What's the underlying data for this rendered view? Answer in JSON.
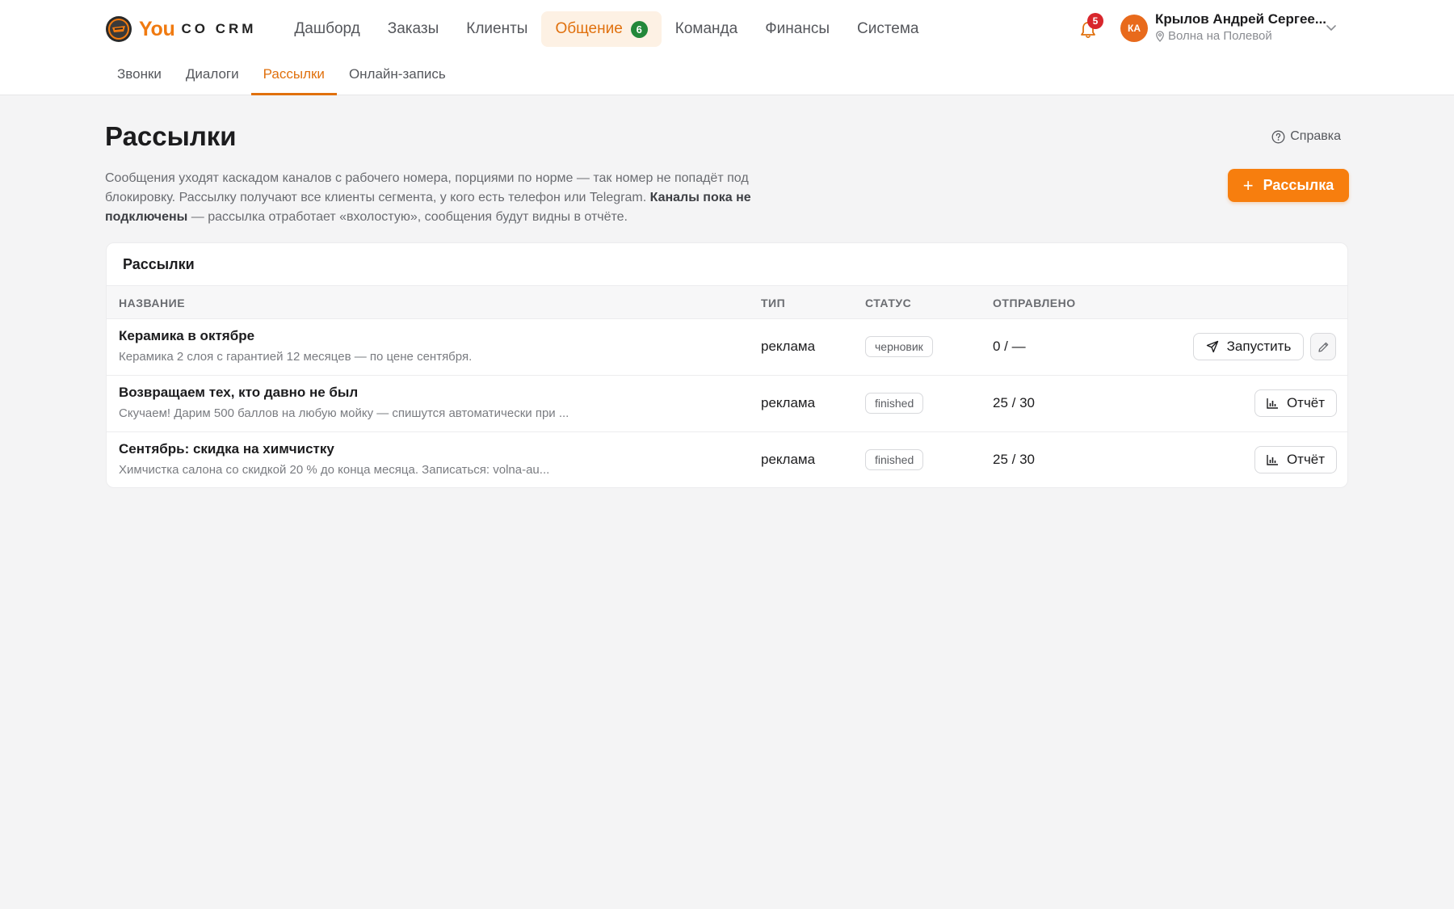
{
  "brand": {
    "you": "You",
    "rest": "CO CRM"
  },
  "nav": {
    "items": [
      {
        "label": "Дашборд",
        "active": false
      },
      {
        "label": "Заказы",
        "active": false
      },
      {
        "label": "Клиенты",
        "active": false
      },
      {
        "label": "Общение",
        "active": true,
        "badge": "6"
      },
      {
        "label": "Команда",
        "active": false
      },
      {
        "label": "Финансы",
        "active": false
      },
      {
        "label": "Система",
        "active": false
      }
    ]
  },
  "notifications": {
    "count": "5",
    "icon": "bell-icon"
  },
  "user": {
    "initials": "КА",
    "name": "Крылов Андрей Сергее...",
    "location": "Волна на Полевой"
  },
  "subnav": {
    "items": [
      {
        "label": "Звонки",
        "active": false
      },
      {
        "label": "Диалоги",
        "active": false
      },
      {
        "label": "Рассылки",
        "active": true
      },
      {
        "label": "Онлайн-запись",
        "active": false
      }
    ]
  },
  "page": {
    "title": "Рассылки",
    "help_label": "Справка",
    "description_1": "Сообщения уходят каскадом каналов с рабочего номера, порциями по норме — так номер не попадёт под блокировку. Рассылку получают все клиенты сегмента, у кого есть телефон или Telegram.",
    "description_bold": "Каналы пока не подключены",
    "description_2": "— рассылка отработает «вхолостую», сообщения будут видны в отчёте.",
    "add_button": "Рассылка"
  },
  "table": {
    "card_title": "Рассылки",
    "columns": {
      "name": "НАЗВАНИЕ",
      "type": "ТИП",
      "status": "СТАТУС",
      "sent": "ОТПРАВЛЕНО"
    },
    "rows": [
      {
        "title": "Керамика в октябре",
        "subtitle": "Керамика 2 слоя с гарантией 12 месяцев — по цене сентября.",
        "type": "реклама",
        "status": "черновик",
        "sent": "0 / —",
        "action": "Запустить"
      },
      {
        "title": "Возвращаем тех, кто давно не был",
        "subtitle": "Скучаем! Дарим 500 баллов на любую мойку — спишутся автоматически при ...",
        "type": "реклама",
        "status": "finished",
        "sent": "25 / 30",
        "action": "Отчёт"
      },
      {
        "title": "Сентябрь: скидка на химчистку",
        "subtitle": "Химчистка салона со скидкой 20 % до конца месяца. Записаться: volna-au...",
        "type": "реклама",
        "status": "finished",
        "sent": "25 / 30",
        "action": "Отчёт"
      }
    ]
  },
  "colors": {
    "accent": "#f77e0e",
    "badge_green": "#23883a",
    "badge_red": "#d8262c"
  }
}
